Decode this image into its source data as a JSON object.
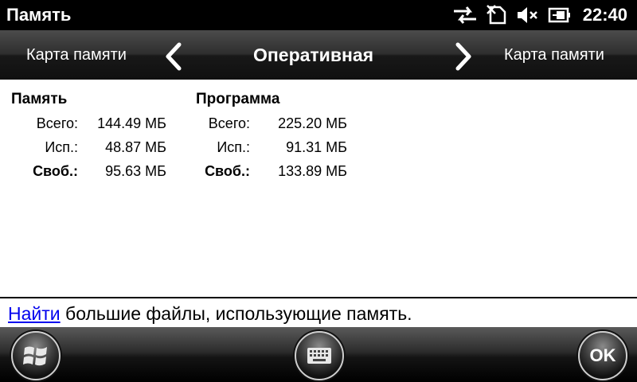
{
  "window": {
    "title": "Память",
    "clock": "22:40"
  },
  "status_icons": [
    "sync-arrows-icon",
    "no-sim-icon",
    "speaker-muted-icon",
    "battery-charging-icon"
  ],
  "tabs": {
    "left": "Карта памяти",
    "current": "Оперативная",
    "right": "Карта памяти"
  },
  "memory": {
    "heading": "Память",
    "rows": [
      {
        "label": "Всего:",
        "value": "144.49 МБ"
      },
      {
        "label": "Исп.:",
        "value": "48.87 МБ"
      },
      {
        "label": "Своб.:",
        "value": "95.63 МБ"
      }
    ]
  },
  "program": {
    "heading": "Программа",
    "rows": [
      {
        "label": "Всего:",
        "value": "225.20 МБ"
      },
      {
        "label": "Исп.:",
        "value": "91.31 МБ"
      },
      {
        "label": "Своб.:",
        "value": "133.89 МБ"
      }
    ]
  },
  "find": {
    "link": "Найти",
    "text": " большие файлы, использующие память."
  },
  "softkeys": {
    "start_icon": "windows-start-icon",
    "keyboard_icon": "keyboard-icon",
    "ok": "OK"
  }
}
